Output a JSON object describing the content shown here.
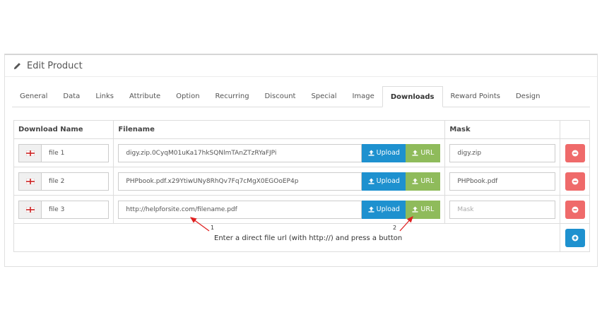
{
  "panel": {
    "title": "Edit Product"
  },
  "tabs": [
    {
      "label": "General"
    },
    {
      "label": "Data"
    },
    {
      "label": "Links"
    },
    {
      "label": "Attribute"
    },
    {
      "label": "Option"
    },
    {
      "label": "Recurring"
    },
    {
      "label": "Discount"
    },
    {
      "label": "Special"
    },
    {
      "label": "Image"
    },
    {
      "label": "Downloads",
      "active": true
    },
    {
      "label": "Reward Points"
    },
    {
      "label": "Design"
    }
  ],
  "table": {
    "headers": {
      "name": "Download Name",
      "filename": "Filename",
      "mask": "Mask"
    },
    "upload_label": "Upload",
    "url_label": "URL",
    "mask_placeholder": "Mask",
    "rows": [
      {
        "name": "file 1",
        "filename": "digy.zip.0CyqM01uKa17hkSQNlmTAnZTzRYaFJPi",
        "mask": "digy.zip"
      },
      {
        "name": "file 2",
        "filename": "PHPbook.pdf.x29YtiwUNy8RhQv7Fq7cMgX0EGOoEP4p",
        "mask": "PHPbook.pdf"
      },
      {
        "name": "file 3",
        "filename": "http://helpforsite.com/filename.pdf",
        "mask": ""
      }
    ]
  },
  "annotation": {
    "text": "Enter a direct file url (with http://) and press a button",
    "marker1": "1",
    "marker2": "2"
  },
  "colors": {
    "upload": "#1e91cf",
    "url": "#8fbb5b",
    "remove": "#ef6a6a",
    "add": "#1e91cf",
    "arrow": "#e02020"
  }
}
